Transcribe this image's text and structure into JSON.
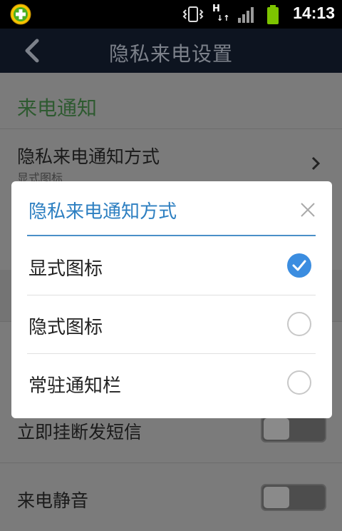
{
  "status_bar": {
    "time": "14:13",
    "network_type": "H"
  },
  "title_bar": {
    "title": "隐私来电设置"
  },
  "page": {
    "section_header": "来电通知",
    "rows": [
      {
        "title": "隐私来电通知方式",
        "subtitle": "显式图标"
      },
      {
        "title": "立即挂断发短信"
      },
      {
        "title": "来电静音"
      }
    ]
  },
  "dialog": {
    "title": "隐私来电通知方式",
    "options": [
      {
        "label": "显式图标",
        "selected": true
      },
      {
        "label": "隐式图标",
        "selected": false
      },
      {
        "label": "常驻通知栏",
        "selected": false
      }
    ]
  },
  "colors": {
    "accent": "#2d7fc1",
    "check_fill": "#3b8de0",
    "section_green": "#2e5a30",
    "titlebar_bg": "#0d1420"
  }
}
